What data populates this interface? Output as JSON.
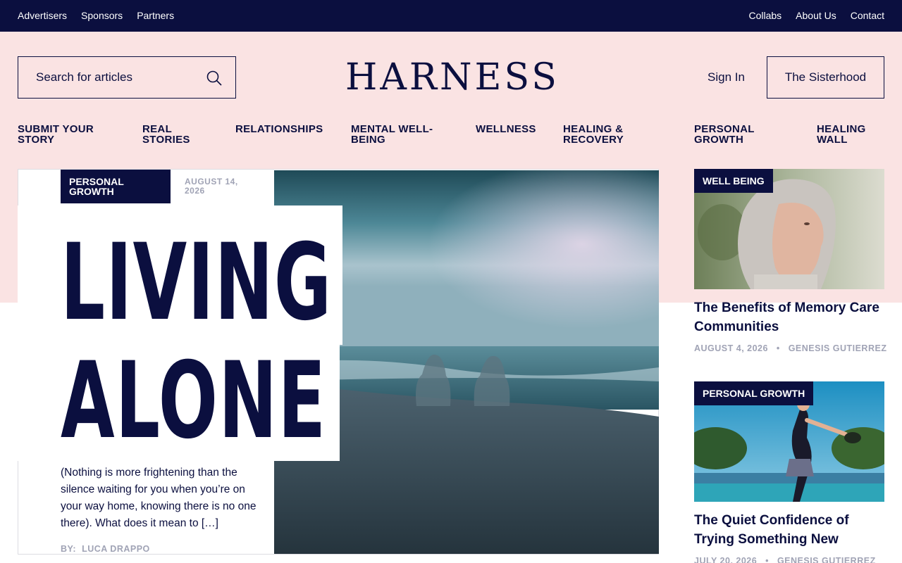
{
  "topbar": {
    "left_links": [
      "Advertisers",
      "Sponsors",
      "Partners"
    ],
    "right_links": [
      "Collabs",
      "About Us",
      "Contact"
    ]
  },
  "header": {
    "search_placeholder": "Search for articles",
    "logo": "HARNESS",
    "sign_in": "Sign In",
    "sisterhood": "The Sisterhood"
  },
  "nav": {
    "items": [
      "SUBMIT YOUR STORY",
      "REAL STORIES",
      "RELATIONSHIPS",
      "MENTAL WELL-BEING",
      "WELLNESS",
      "HEALING & RECOVERY",
      "PERSONAL GROWTH",
      "HEALING WALL"
    ]
  },
  "featured": {
    "category": "PERSONAL GROWTH",
    "date": "AUGUST 14, 2026",
    "title_line1": "LIVING",
    "title_line2": "ALONE",
    "excerpt": "(Nothing is more frightening than the silence waiting for you when you’re on your way home, knowing there is no one there). What does it mean to […]",
    "byline_prefix": "BY:",
    "author": "LUCA DRAPPO"
  },
  "sidebar": {
    "cards": [
      {
        "category": "WELL BEING",
        "title": "The Benefits of Memory Care Communities",
        "date": "AUGUST 4, 2026",
        "author": "GENESIS GUTIERREZ"
      },
      {
        "category": "PERSONAL GROWTH",
        "title": "The Quiet Confidence of Trying Something New",
        "date": "JULY 20, 2026",
        "author": "GENESIS GUTIERREZ"
      }
    ]
  },
  "colors": {
    "navy": "#0b0f3f",
    "pink": "#fae3e3",
    "meta_gray": "#a0a3b5"
  }
}
